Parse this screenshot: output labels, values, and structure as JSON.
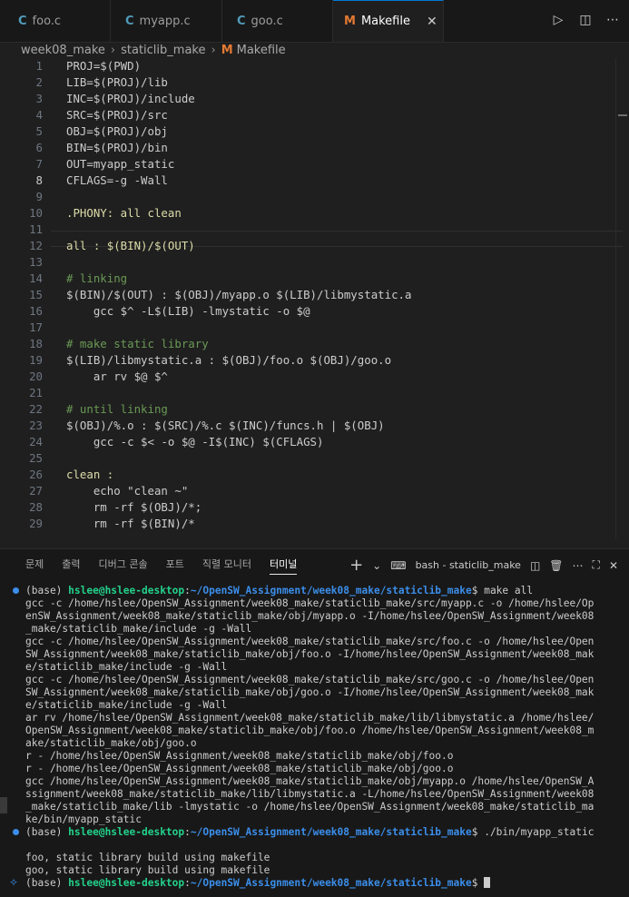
{
  "tabs": [
    {
      "icon": "C",
      "label": "foo.c"
    },
    {
      "icon": "C",
      "label": "myapp.c"
    },
    {
      "icon": "C",
      "label": "goo.c"
    },
    {
      "icon": "M",
      "label": "Makefile",
      "close": "✕"
    }
  ],
  "breadcrumb": {
    "parts": [
      "week08_make",
      "staticlib_make",
      "Makefile"
    ],
    "sep": "›"
  },
  "editor": {
    "current_line": 8,
    "lines": [
      {
        "n": "1",
        "t": "PROJ=$(PWD)"
      },
      {
        "n": "2",
        "t": "LIB=$(PROJ)/lib"
      },
      {
        "n": "3",
        "t": "INC=$(PROJ)/include"
      },
      {
        "n": "4",
        "t": "SRC=$(PROJ)/src"
      },
      {
        "n": "5",
        "t": "OBJ=$(PROJ)/obj"
      },
      {
        "n": "6",
        "t": "BIN=$(PROJ)/bin"
      },
      {
        "n": "7",
        "t": "OUT=myapp_static"
      },
      {
        "n": "8",
        "t": "CFLAGS=-g -Wall"
      },
      {
        "n": "9",
        "t": ""
      },
      {
        "n": "10",
        "t": ".PHONY: all clean"
      },
      {
        "n": "11",
        "t": ""
      },
      {
        "n": "12",
        "t": "all : $(BIN)/$(OUT)"
      },
      {
        "n": "13",
        "t": ""
      },
      {
        "n": "14",
        "t": "# linking"
      },
      {
        "n": "15",
        "t": "$(BIN)/$(OUT) : $(OBJ)/myapp.o $(LIB)/libmystatic.a"
      },
      {
        "n": "16",
        "t": "    gcc $^ -L$(LIB) -lmystatic -o $@"
      },
      {
        "n": "17",
        "t": ""
      },
      {
        "n": "18",
        "t": "# make static library"
      },
      {
        "n": "19",
        "t": "$(LIB)/libmystatic.a : $(OBJ)/foo.o $(OBJ)/goo.o"
      },
      {
        "n": "20",
        "t": "    ar rv $@ $^"
      },
      {
        "n": "21",
        "t": ""
      },
      {
        "n": "22",
        "t": "# until linking"
      },
      {
        "n": "23",
        "t": "$(OBJ)/%.o : $(SRC)/%.c $(INC)/funcs.h | $(OBJ)"
      },
      {
        "n": "24",
        "t": "    gcc -c $< -o $@ -I$(INC) $(CFLAGS)"
      },
      {
        "n": "25",
        "t": ""
      },
      {
        "n": "26",
        "t": "clean :"
      },
      {
        "n": "27",
        "t": "    echo \"clean ~\""
      },
      {
        "n": "28",
        "t": "    rm -rf $(OBJ)/*;"
      },
      {
        "n": "29",
        "t": "    rm -rf $(BIN)/*"
      }
    ]
  },
  "panel": {
    "tabs": [
      "문제",
      "출력",
      "디버그 콘솔",
      "포트",
      "직렬 모니터",
      "터미널"
    ],
    "active_tab": "터미널",
    "terminal_name": "bash - staticlib_make",
    "add": "+",
    "dropdown": "⌄",
    "maximize": "⛶",
    "close": "✕"
  },
  "terminal": {
    "prompts": [
      {
        "prefix": "(base) ",
        "user": "hslee@hslee-desktop",
        "colon": ":",
        "path": "~/OpenSW_Assignment/week08_make/staticlib_make",
        "cmd": "$ make all"
      },
      {
        "prefix": "(base) ",
        "user": "hslee@hslee-desktop",
        "colon": ":",
        "path": "~/OpenSW_Assignment/week08_make/staticlib_make",
        "cmd": "$ ./bin/myapp_static"
      },
      {
        "prefix": "(base) ",
        "user": "hslee@hslee-desktop",
        "colon": ":",
        "path": "~/OpenSW_Assignment/week08_make/staticlib_make",
        "cmd": "$ "
      }
    ],
    "output1": [
      "gcc -c /home/hslee/OpenSW_Assignment/week08_make/staticlib_make/src/myapp.c -o /home/hslee/Op",
      "enSW_Assignment/week08_make/staticlib_make/obj/myapp.o -I/home/hslee/OpenSW_Assignment/week08",
      "_make/staticlib_make/include -g -Wall",
      "gcc -c /home/hslee/OpenSW_Assignment/week08_make/staticlib_make/src/foo.c -o /home/hslee/Open",
      "SW_Assignment/week08_make/staticlib_make/obj/foo.o -I/home/hslee/OpenSW_Assignment/week08_mak",
      "e/staticlib_make/include -g -Wall",
      "gcc -c /home/hslee/OpenSW_Assignment/week08_make/staticlib_make/src/goo.c -o /home/hslee/Open",
      "SW_Assignment/week08_make/staticlib_make/obj/goo.o -I/home/hslee/OpenSW_Assignment/week08_mak",
      "e/staticlib_make/include -g -Wall",
      "ar rv /home/hslee/OpenSW_Assignment/week08_make/staticlib_make/lib/libmystatic.a /home/hslee/",
      "OpenSW_Assignment/week08_make/staticlib_make/obj/foo.o /home/hslee/OpenSW_Assignment/week08_m",
      "ake/staticlib_make/obj/goo.o",
      "r - /home/hslee/OpenSW_Assignment/week08_make/staticlib_make/obj/foo.o",
      "r - /home/hslee/OpenSW_Assignment/week08_make/staticlib_make/obj/goo.o",
      "gcc /home/hslee/OpenSW_Assignment/week08_make/staticlib_make/obj/myapp.o /home/hslee/OpenSW_A",
      "ssignment/week08_make/staticlib_make/lib/libmystatic.a -L/home/hslee/OpenSW_Assignment/week08",
      "_make/staticlib_make/lib -lmystatic -o /home/hslee/OpenSW_Assignment/week08_make/staticlib_ma",
      "ke/bin/myapp_static"
    ],
    "output2": [
      "",
      "foo, static library build using makefile",
      "goo, static library build using makefile"
    ]
  }
}
